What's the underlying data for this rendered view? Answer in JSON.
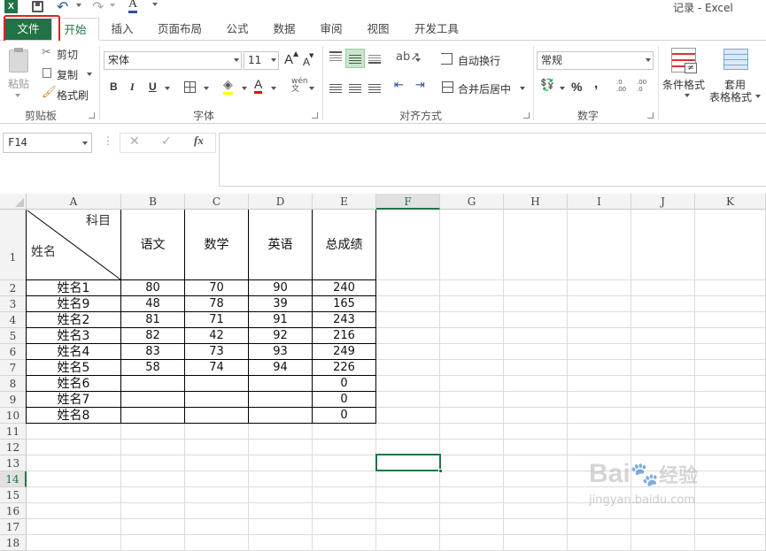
{
  "app": {
    "window_title": "记录 - Excel"
  },
  "tabs": [
    "文件",
    "开始",
    "插入",
    "页面布局",
    "公式",
    "数据",
    "审阅",
    "视图",
    "开发工具"
  ],
  "ribbon": {
    "clipboard": {
      "paste": "粘贴",
      "cut": "剪切",
      "copy": "复制",
      "format_painter": "格式刷",
      "label": "剪贴板"
    },
    "font": {
      "name": "宋体",
      "size": "11",
      "label": "字体",
      "bold": "B",
      "italic": "I",
      "underline": "U",
      "grow": "A",
      "shrink": "A",
      "color_a": "A"
    },
    "alignment": {
      "wrap": "自动换行",
      "merge": "合并后居中",
      "label": "对齐方式"
    },
    "number": {
      "format": "常规",
      "percent": "%",
      "comma": ",",
      "label": "数字",
      "inc": ".0 .00",
      "dec": ".00 .0"
    },
    "styles": {
      "conditional": "条件格式",
      "table_line1": "套用",
      "table_line2": "表格格式"
    }
  },
  "formula_bar": {
    "name_box": "F14",
    "fx": "fx",
    "content": ""
  },
  "columns": [
    "A",
    "B",
    "C",
    "D",
    "E",
    "F",
    "G",
    "H",
    "I",
    "J",
    "K"
  ],
  "rows": [
    "1",
    "2",
    "3",
    "4",
    "5",
    "6",
    "7",
    "8",
    "9",
    "10",
    "11",
    "12",
    "13",
    "14",
    "15",
    "16",
    "17",
    "18"
  ],
  "table": {
    "header_diag_top": "科目",
    "header_diag_bottom": "姓名",
    "headers": [
      "语文",
      "数学",
      "英语",
      "总成绩"
    ],
    "rows": [
      [
        "姓名1",
        "80",
        "70",
        "90",
        "240"
      ],
      [
        "姓名9",
        "48",
        "78",
        "39",
        "165"
      ],
      [
        "姓名2",
        "81",
        "71",
        "91",
        "243"
      ],
      [
        "姓名3",
        "82",
        "42",
        "92",
        "216"
      ],
      [
        "姓名4",
        "83",
        "73",
        "93",
        "249"
      ],
      [
        "姓名5",
        "58",
        "74",
        "94",
        "226"
      ],
      [
        "姓名6",
        "",
        "",
        "",
        "0"
      ],
      [
        "姓名7",
        "",
        "",
        "",
        "0"
      ],
      [
        "姓名8",
        "",
        "",
        "",
        "0"
      ]
    ]
  },
  "selected_cell": "F14",
  "watermark": {
    "text1": "Bai",
    "text2": "经验",
    "url": "jingyan.baidu.com"
  },
  "colors": {
    "excel_green": "#217346",
    "highlight_red": "#e02020"
  }
}
